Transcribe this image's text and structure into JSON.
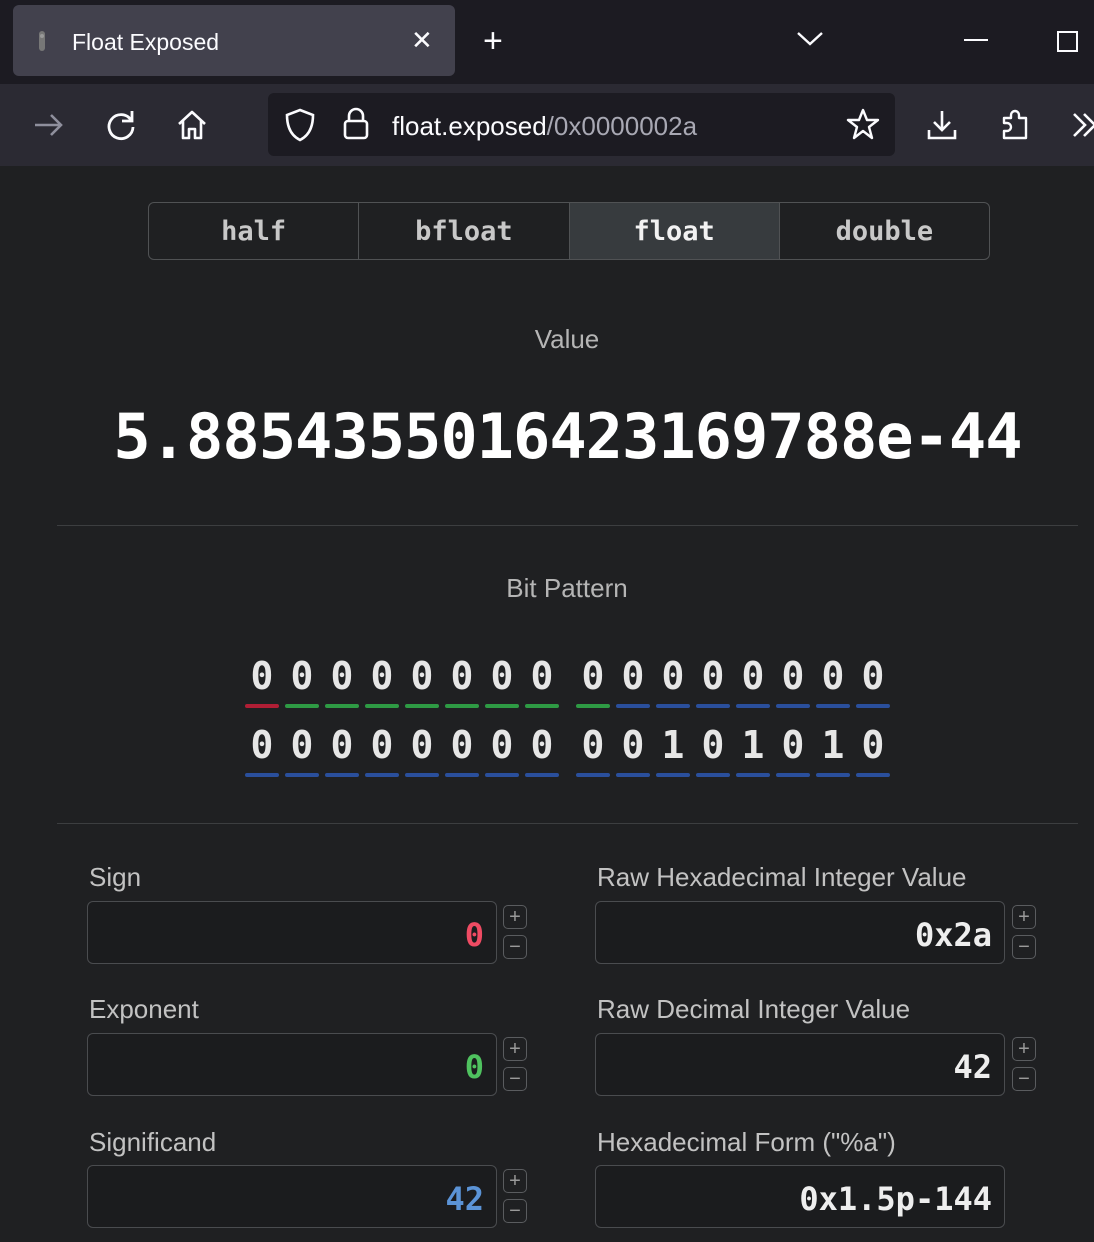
{
  "browser": {
    "tab_title": "Float Exposed",
    "url_host": "float.exposed",
    "url_path": "/0x0000002a"
  },
  "types": [
    {
      "label": "half",
      "active": false
    },
    {
      "label": "bfloat",
      "active": false
    },
    {
      "label": "float",
      "active": true
    },
    {
      "label": "double",
      "active": false
    }
  ],
  "value_section": {
    "title": "Value",
    "value": "5.8854355016423169788e-44"
  },
  "bit_section": {
    "title": "Bit Pattern",
    "bits": "00000000000000000000000000101010",
    "colors": {
      "sign": "#b01e35",
      "exponent": "#2e9a44",
      "significand": "#2a4f9c"
    }
  },
  "fields": {
    "sign": {
      "label": "Sign",
      "value": "0",
      "color": "#ef4b63"
    },
    "exponent": {
      "label": "Exponent",
      "value": "0",
      "color": "#4fc25f"
    },
    "significand": {
      "label": "Significand",
      "value": "42",
      "color": "#5b93d6"
    },
    "raw_hex": {
      "label": "Raw Hexadecimal Integer Value",
      "value": "0x2a"
    },
    "raw_dec": {
      "label": "Raw Decimal Integer Value",
      "value": "42"
    },
    "hex_form": {
      "label": "Hexadecimal Form (\"%a\")",
      "value": "0x1.5p-144"
    }
  },
  "steppers": {
    "plus": "+",
    "minus": "−"
  },
  "icons": [
    "forward-icon",
    "reload-icon",
    "home-icon",
    "shield-icon",
    "lock-icon",
    "bookmark-star-icon",
    "download-icon",
    "extensions-icon",
    "overflow-icon",
    "tab-list-icon",
    "minimize-icon",
    "maximize-icon",
    "close-icon",
    "new-tab-icon"
  ]
}
